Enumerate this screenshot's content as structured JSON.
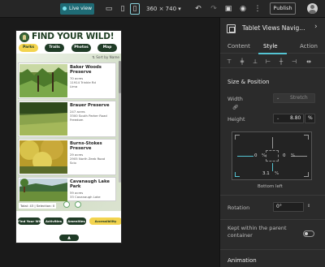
{
  "toolbar": {
    "live_view_label": "Live view",
    "size_label": "360 × 740",
    "publish_label": "Publish"
  },
  "app": {
    "title": "FIND YOUR WILD!",
    "tabs": [
      {
        "label": "Parks",
        "active": true
      },
      {
        "label": "Trails",
        "active": false
      },
      {
        "label": "Photos",
        "active": false
      },
      {
        "label": "Map",
        "active": false
      }
    ],
    "sort_label": "Sort by Name",
    "items": [
      {
        "name": "Baker Woods Preserve",
        "acres": "70 acres",
        "address": "11914 Trinkle Rd",
        "city": "Lima"
      },
      {
        "name": "Brauer Preserve",
        "acres": "247 acres",
        "address": "3300 South Parker Road",
        "city": "Freedom"
      },
      {
        "name": "Burns-Stokes Preserve",
        "acres": "29 acres",
        "address": "2905 North Zeeb Road",
        "city": "Scio"
      },
      {
        "name": "Cavanaugh Lake Park",
        "acres": "59 acres",
        "address": "33 Cavanaugh Lake",
        "city": ""
      }
    ],
    "total_label": "Total: 43 | Selection: 0",
    "bottom_tabs": [
      {
        "label": "Find Your Wild",
        "active": false
      },
      {
        "label": "Activities",
        "active": false
      },
      {
        "label": "Amenities",
        "active": false
      },
      {
        "label": "Accessibility",
        "active": true
      }
    ],
    "up_label": "▲"
  },
  "panel": {
    "title": "Tablet Views Navig...",
    "tabs": [
      {
        "label": "Content",
        "active": false
      },
      {
        "label": "Style",
        "active": true
      },
      {
        "label": "Action",
        "active": false
      }
    ],
    "section_title": "Size & Position",
    "width_label": "Width",
    "width_value": "Stretch",
    "height_label": "Height",
    "height_value": "8.80",
    "height_unit": "%",
    "left_value": "0",
    "right_value": "0",
    "bottom_value": "3.1",
    "pct": "%",
    "anchor_label": "Bottom left",
    "rotation_label": "Rotation",
    "rotation_value": "0°",
    "kept_label": "Kept within the parent container",
    "animation_label": "Animation"
  }
}
